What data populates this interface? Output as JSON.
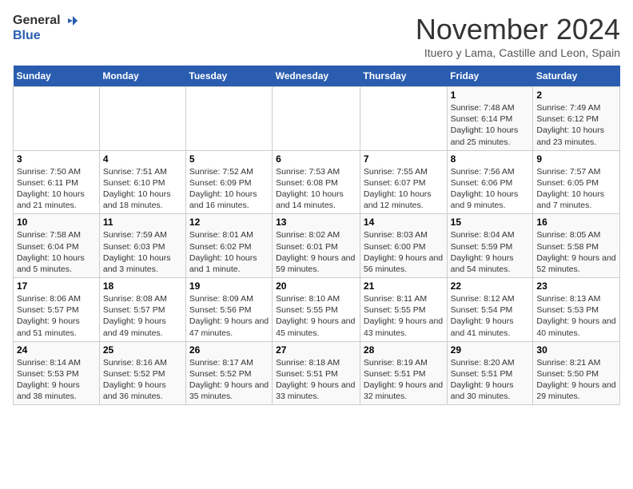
{
  "header": {
    "logo_general": "General",
    "logo_blue": "Blue",
    "month_year": "November 2024",
    "location": "Ituero y Lama, Castille and Leon, Spain"
  },
  "days_of_week": [
    "Sunday",
    "Monday",
    "Tuesday",
    "Wednesday",
    "Thursday",
    "Friday",
    "Saturday"
  ],
  "weeks": [
    [
      {
        "day": "",
        "info": ""
      },
      {
        "day": "",
        "info": ""
      },
      {
        "day": "",
        "info": ""
      },
      {
        "day": "",
        "info": ""
      },
      {
        "day": "",
        "info": ""
      },
      {
        "day": "1",
        "info": "Sunrise: 7:48 AM\nSunset: 6:14 PM\nDaylight: 10 hours and 25 minutes."
      },
      {
        "day": "2",
        "info": "Sunrise: 7:49 AM\nSunset: 6:12 PM\nDaylight: 10 hours and 23 minutes."
      }
    ],
    [
      {
        "day": "3",
        "info": "Sunrise: 7:50 AM\nSunset: 6:11 PM\nDaylight: 10 hours and 21 minutes."
      },
      {
        "day": "4",
        "info": "Sunrise: 7:51 AM\nSunset: 6:10 PM\nDaylight: 10 hours and 18 minutes."
      },
      {
        "day": "5",
        "info": "Sunrise: 7:52 AM\nSunset: 6:09 PM\nDaylight: 10 hours and 16 minutes."
      },
      {
        "day": "6",
        "info": "Sunrise: 7:53 AM\nSunset: 6:08 PM\nDaylight: 10 hours and 14 minutes."
      },
      {
        "day": "7",
        "info": "Sunrise: 7:55 AM\nSunset: 6:07 PM\nDaylight: 10 hours and 12 minutes."
      },
      {
        "day": "8",
        "info": "Sunrise: 7:56 AM\nSunset: 6:06 PM\nDaylight: 10 hours and 9 minutes."
      },
      {
        "day": "9",
        "info": "Sunrise: 7:57 AM\nSunset: 6:05 PM\nDaylight: 10 hours and 7 minutes."
      }
    ],
    [
      {
        "day": "10",
        "info": "Sunrise: 7:58 AM\nSunset: 6:04 PM\nDaylight: 10 hours and 5 minutes."
      },
      {
        "day": "11",
        "info": "Sunrise: 7:59 AM\nSunset: 6:03 PM\nDaylight: 10 hours and 3 minutes."
      },
      {
        "day": "12",
        "info": "Sunrise: 8:01 AM\nSunset: 6:02 PM\nDaylight: 10 hours and 1 minute."
      },
      {
        "day": "13",
        "info": "Sunrise: 8:02 AM\nSunset: 6:01 PM\nDaylight: 9 hours and 59 minutes."
      },
      {
        "day": "14",
        "info": "Sunrise: 8:03 AM\nSunset: 6:00 PM\nDaylight: 9 hours and 56 minutes."
      },
      {
        "day": "15",
        "info": "Sunrise: 8:04 AM\nSunset: 5:59 PM\nDaylight: 9 hours and 54 minutes."
      },
      {
        "day": "16",
        "info": "Sunrise: 8:05 AM\nSunset: 5:58 PM\nDaylight: 9 hours and 52 minutes."
      }
    ],
    [
      {
        "day": "17",
        "info": "Sunrise: 8:06 AM\nSunset: 5:57 PM\nDaylight: 9 hours and 51 minutes."
      },
      {
        "day": "18",
        "info": "Sunrise: 8:08 AM\nSunset: 5:57 PM\nDaylight: 9 hours and 49 minutes."
      },
      {
        "day": "19",
        "info": "Sunrise: 8:09 AM\nSunset: 5:56 PM\nDaylight: 9 hours and 47 minutes."
      },
      {
        "day": "20",
        "info": "Sunrise: 8:10 AM\nSunset: 5:55 PM\nDaylight: 9 hours and 45 minutes."
      },
      {
        "day": "21",
        "info": "Sunrise: 8:11 AM\nSunset: 5:55 PM\nDaylight: 9 hours and 43 minutes."
      },
      {
        "day": "22",
        "info": "Sunrise: 8:12 AM\nSunset: 5:54 PM\nDaylight: 9 hours and 41 minutes."
      },
      {
        "day": "23",
        "info": "Sunrise: 8:13 AM\nSunset: 5:53 PM\nDaylight: 9 hours and 40 minutes."
      }
    ],
    [
      {
        "day": "24",
        "info": "Sunrise: 8:14 AM\nSunset: 5:53 PM\nDaylight: 9 hours and 38 minutes."
      },
      {
        "day": "25",
        "info": "Sunrise: 8:16 AM\nSunset: 5:52 PM\nDaylight: 9 hours and 36 minutes."
      },
      {
        "day": "26",
        "info": "Sunrise: 8:17 AM\nSunset: 5:52 PM\nDaylight: 9 hours and 35 minutes."
      },
      {
        "day": "27",
        "info": "Sunrise: 8:18 AM\nSunset: 5:51 PM\nDaylight: 9 hours and 33 minutes."
      },
      {
        "day": "28",
        "info": "Sunrise: 8:19 AM\nSunset: 5:51 PM\nDaylight: 9 hours and 32 minutes."
      },
      {
        "day": "29",
        "info": "Sunrise: 8:20 AM\nSunset: 5:51 PM\nDaylight: 9 hours and 30 minutes."
      },
      {
        "day": "30",
        "info": "Sunrise: 8:21 AM\nSunset: 5:50 PM\nDaylight: 9 hours and 29 minutes."
      }
    ]
  ]
}
